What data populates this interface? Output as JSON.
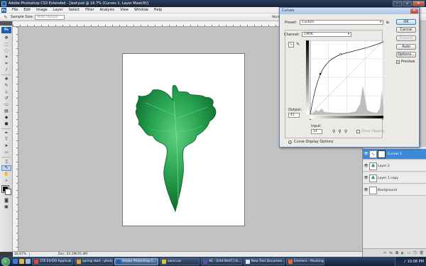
{
  "window": {
    "title": "Adobe Photoshop CS3 Extended - [leaf.psd @ 16.7% (Curves 1, Layer Mask/8)]"
  },
  "menu": [
    "File",
    "Edit",
    "Image",
    "Layer",
    "Select",
    "Filter",
    "Analysis",
    "View",
    "Window",
    "Help"
  ],
  "options": {
    "sample_size_label": "Sample Size:",
    "sample_size_value": "Point Sample",
    "workspace_label": "Worksp"
  },
  "status": {
    "zoom": "16.67%",
    "doc": "Doc: 22.2M/35.4M"
  },
  "curves": {
    "title": "Curves",
    "preset_label": "Preset:",
    "preset_value": "Custom",
    "channel_label": "Channel:",
    "channel_value": "CMYK",
    "output_label": "Output:",
    "output_value": "41",
    "input_label": "Input:",
    "input_value": "14",
    "show_clipping_label": "Show Clipping",
    "display_options_label": "Curve Display Options",
    "buttons": {
      "ok": "OK",
      "cancel": "Cancel",
      "smooth": "Smooth",
      "auto": "Auto",
      "options": "Options..."
    },
    "preview_label": "Preview"
  },
  "layers": [
    {
      "name": "Curves 1",
      "selected": true
    },
    {
      "name": "Layer 2",
      "selected": false
    },
    {
      "name": "Layer 1 copy",
      "selected": false
    },
    {
      "name": "Background",
      "selected": false
    }
  ],
  "taskbar": {
    "tasks": [
      "2TE EV-DO Applicat...",
      "spring start - photo...",
      "Adobe Photoshop C...",
      "sand car",
      "AE - [kAd 8eVC] (k...",
      "New Text Documen...",
      "Emmers - Mocking..."
    ],
    "clock": "10:08 PM"
  },
  "colors": {
    "leaf_dark": "#0b6a2c",
    "leaf_mid": "#1e9a48",
    "leaf_light": "#48c06e",
    "selection_blue": "#3d88d8"
  }
}
